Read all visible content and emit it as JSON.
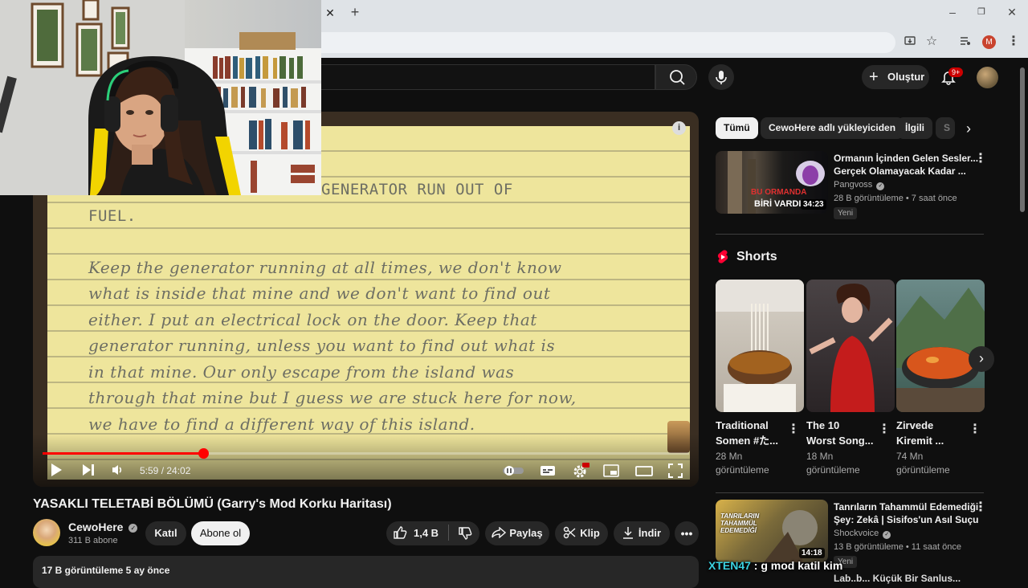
{
  "browser": {
    "tab_close": "✕",
    "new_tab": "+",
    "profile_initial": "M"
  },
  "youtube": {
    "create_label": "Oluştur",
    "notifications": "9+"
  },
  "player": {
    "time": "5:59 / 24:02",
    "progress_fraction": 0.249,
    "note_lines": [
      "GENERATOR RUN OUT OF",
      "FUEL.",
      "Keep the generator running at all times, we don't know",
      "what is inside that mine and we don't want to find out",
      "either. I put an electrical lock on the door. Keep that",
      "generator running, unless you want to find out what is",
      "in that mine. Our only escape from the island was",
      "through that mine but I guess we are stuck here for now,",
      "we have to find a different way of this island."
    ]
  },
  "video": {
    "title": "YASAKLI TELETABİ BÖLÜMÜ (Garry's Mod Korku Haritası)",
    "channel": "CewoHere",
    "subscribers": "311 B abone",
    "join_label": "Katıl",
    "subscribe_label": "Abone ol",
    "likes": "1,4 B",
    "share_label": "Paylaş",
    "clip_label": "Klip",
    "download_label": "İndir",
    "views_date": "17 B görüntüleme  5 ay önce"
  },
  "sidebar": {
    "chips": [
      "Tümü",
      "CewoHere adlı yükleyiciden",
      "İlgili",
      "S"
    ],
    "rec1": {
      "title_line1": "Ormanın İçinden Gelen Sesler...",
      "title_line2": "Gerçek Olamayacak Kadar ...",
      "channel": "Pangvoss",
      "meta": "28 B görüntüleme • 7 saat önce",
      "badge": "Yeni",
      "duration": "34:23",
      "thumb_text1": "BU ORMANDA",
      "thumb_text2": "BİRİ VARDI"
    },
    "shorts_heading": "Shorts",
    "shorts": [
      {
        "title1": "Traditional",
        "title2": "Somen #た...",
        "views1": "28 Mn",
        "views2": "görüntüleme"
      },
      {
        "title1": "The 10",
        "title2": "Worst Song...",
        "views1": "18 Mn",
        "views2": "görüntüleme"
      },
      {
        "title1": "Zirvede",
        "title2": "Kiremit ...",
        "views1": "74 Mn",
        "views2": "görüntüleme"
      }
    ],
    "rec2": {
      "title_line1": "Tanrıların Tahammül Edemediği",
      "title_line2": "Şey: Zekâ | Sisifos'un Asıl Suçu",
      "channel": "Shockvoice",
      "meta": "13 B görüntüleme • 11 saat önce",
      "badge": "Yeni",
      "duration": "14:18",
      "thumb_text": "TANRILARIN TAHAMMÜL EDEMEDİĞİ",
      "next_title": "Lab..b... Küçük Bir Sanlus..."
    }
  },
  "chat": {
    "user": "XTEN47",
    "message": " : g mod katil kim"
  }
}
